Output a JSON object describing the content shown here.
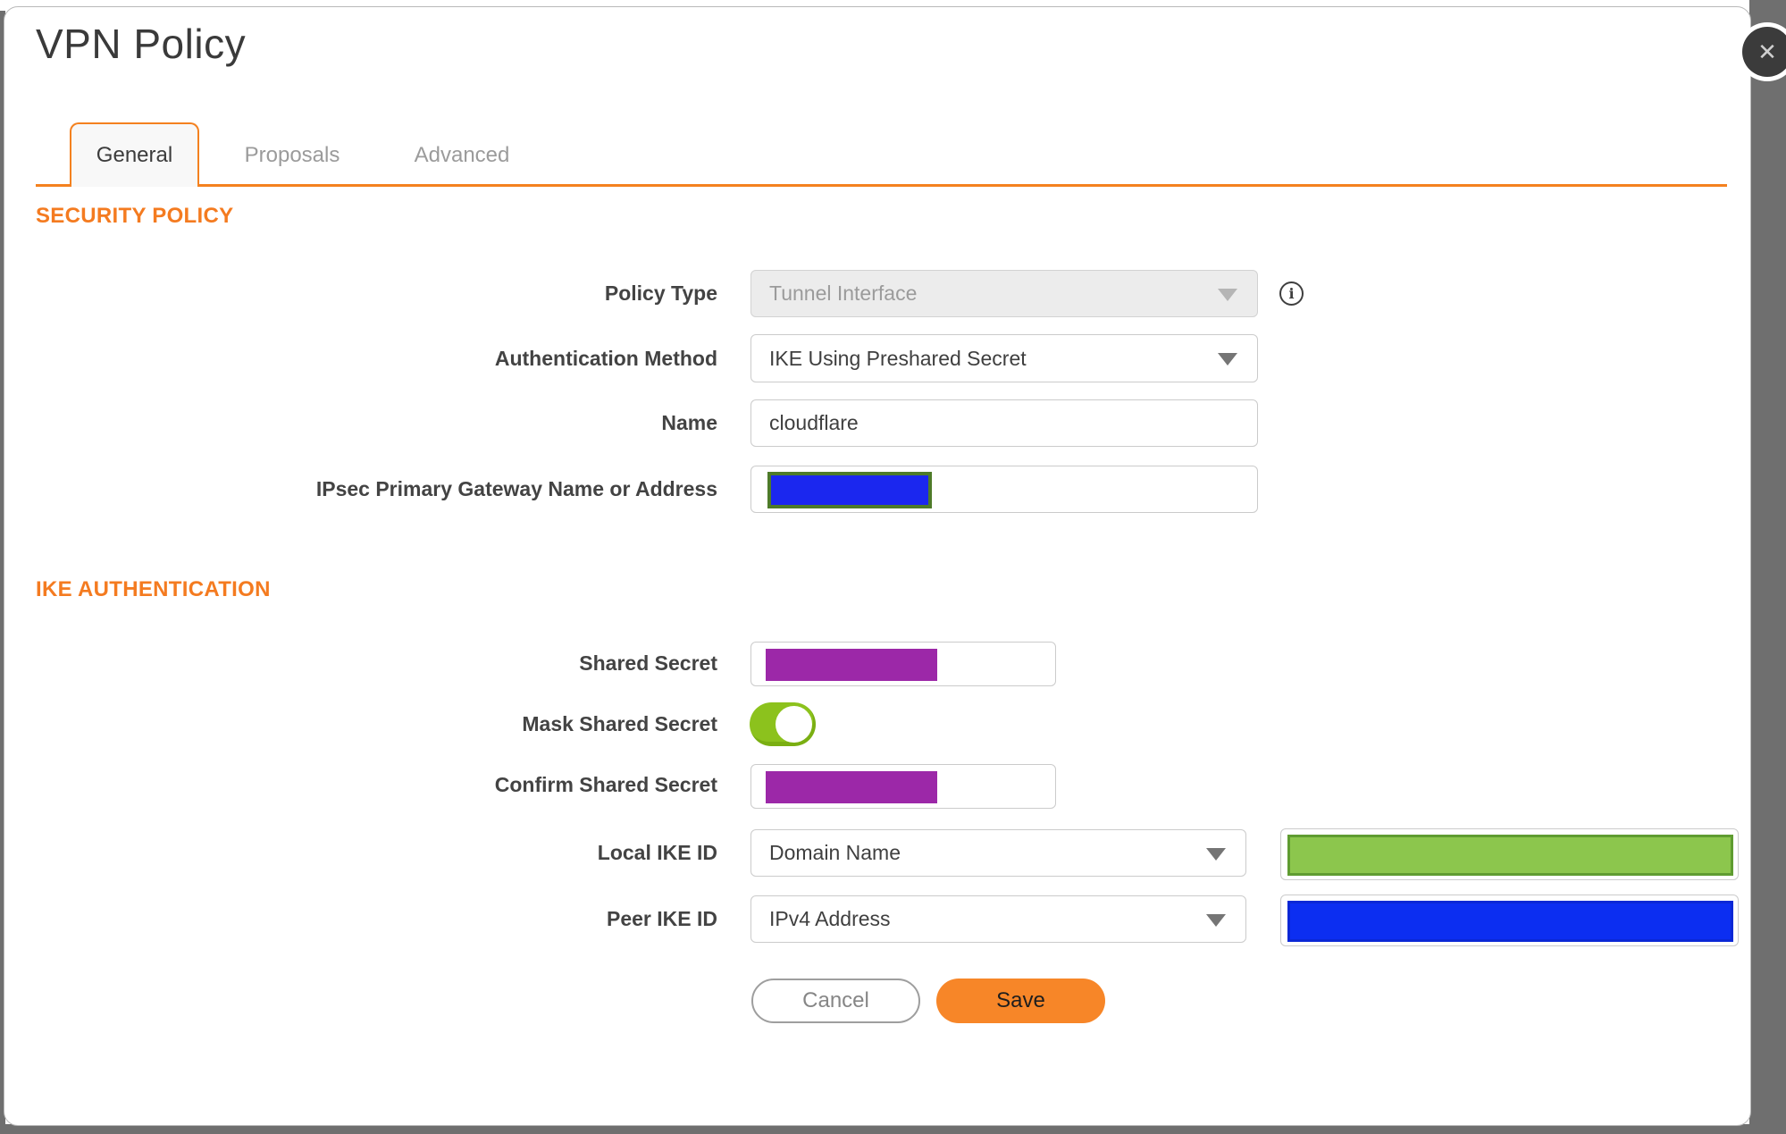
{
  "title": "VPN Policy",
  "close_icon": "✕",
  "info_icon": "i",
  "tabs": {
    "general": "General",
    "proposals": "Proposals",
    "advanced": "Advanced",
    "active": "General"
  },
  "sections": {
    "security_policy": "SECURITY POLICY",
    "ike_authentication": "IKE AUTHENTICATION"
  },
  "fields": {
    "policy_type": {
      "label": "Policy Type",
      "value": "Tunnel Interface",
      "disabled": true
    },
    "authentication_method": {
      "label": "Authentication Method",
      "value": "IKE Using Preshared Secret"
    },
    "name": {
      "label": "Name",
      "value": "cloudflare"
    },
    "gateway": {
      "label": "IPsec Primary Gateway Name or Address",
      "redacted": true
    },
    "shared_secret": {
      "label": "Shared Secret",
      "redacted": true
    },
    "mask_shared_secret": {
      "label": "Mask Shared Secret",
      "state": "on"
    },
    "confirm_shared_secret": {
      "label": "Confirm Shared Secret",
      "redacted": true
    },
    "local_ike_id": {
      "label": "Local IKE ID",
      "value": "Domain Name",
      "id_redacted": true
    },
    "peer_ike_id": {
      "label": "Peer IKE ID",
      "value": "IPv4 Address",
      "id_redacted": true
    }
  },
  "buttons": {
    "cancel": "Cancel",
    "save": "Save"
  },
  "colors": {
    "accent_orange": "#f4811f",
    "save_orange": "#f78628",
    "toggle_green": "#8cc21d",
    "redaction_purple": "#9c28a8",
    "redaction_blue": "#1b27ef",
    "redaction_green": "#8cc64d",
    "redaction_green_border": "#5f9c31",
    "redaction_olive_border": "#4e7b29",
    "background_gray": "#6f6f6f"
  }
}
